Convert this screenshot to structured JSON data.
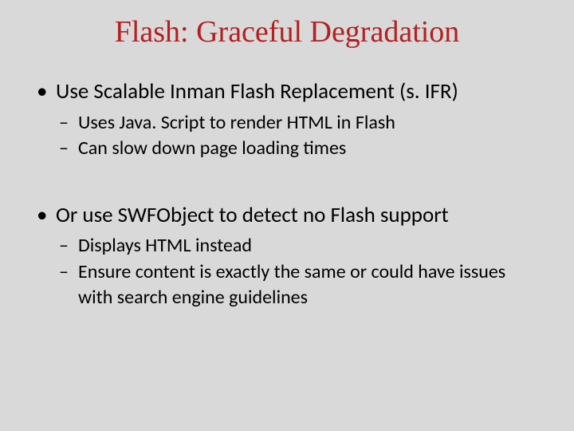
{
  "title": "Flash: Graceful Degradation",
  "bullets": [
    {
      "text": "Use Scalable Inman Flash Replacement (s. IFR)",
      "sub": [
        "Uses Java. Script to render HTML in Flash",
        "Can slow down page loading times"
      ]
    },
    {
      "text": "Or use SWFObject to detect no Flash support",
      "sub": [
        "Displays HTML instead",
        "Ensure content is exactly the same or could have issues with search engine guidelines"
      ]
    }
  ]
}
